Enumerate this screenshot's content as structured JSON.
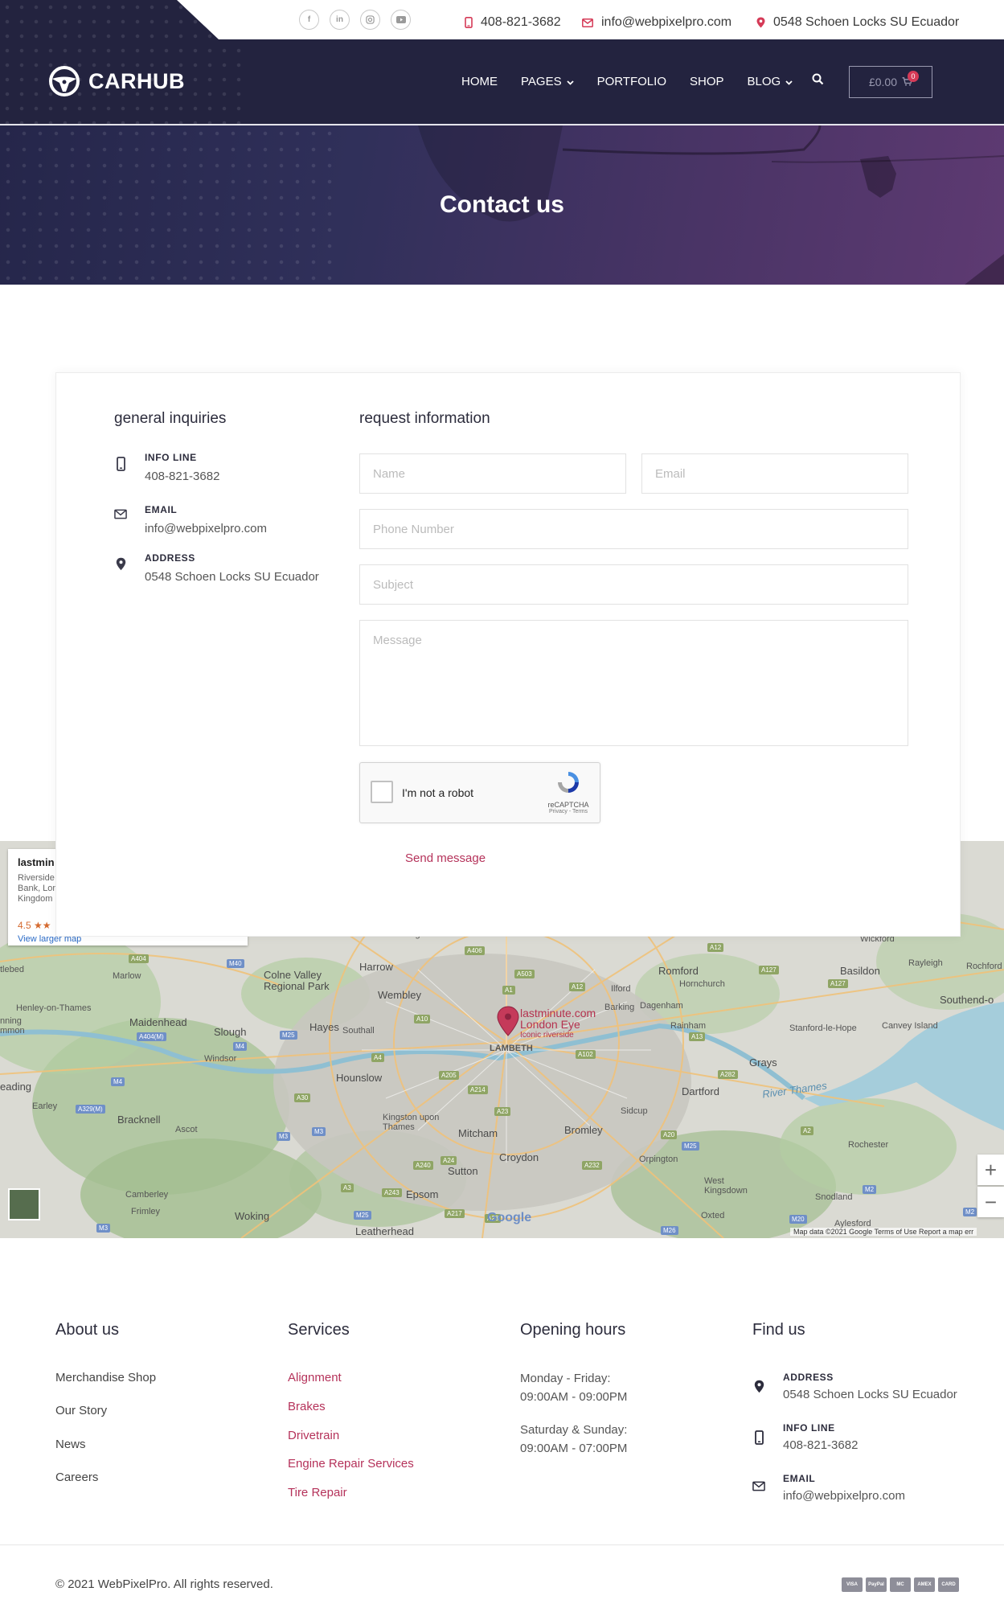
{
  "topbar": {
    "socials": [
      "facebook-icon",
      "linkedin-icon",
      "instagram-icon",
      "youtube-icon"
    ],
    "phone": "408-821-3682",
    "email": "info@webpixelpro.com",
    "address": "0548 Schoen Locks SU Ecuador"
  },
  "brand": {
    "name": "CARHUB"
  },
  "nav": {
    "items": [
      {
        "label": "HOME",
        "dropdown": false
      },
      {
        "label": "PAGES",
        "dropdown": true
      },
      {
        "label": "PORTFOLIO",
        "dropdown": false
      },
      {
        "label": "SHOP",
        "dropdown": false
      },
      {
        "label": "BLOG",
        "dropdown": true
      }
    ],
    "cart_amount": "£0.00",
    "cart_count": "0"
  },
  "hero": {
    "title": "Contact us"
  },
  "inquiries": {
    "heading": "general inquiries",
    "items": [
      {
        "icon": "phone-icon",
        "label": "INFO LINE",
        "value": "408-821-3682"
      },
      {
        "icon": "mail-icon",
        "label": "EMAIL",
        "value": "info@webpixelpro.com"
      },
      {
        "icon": "map-pin-icon",
        "label": "ADDRESS",
        "value": "0548 Schoen Locks SU Ecuador"
      }
    ]
  },
  "form": {
    "heading": "request information",
    "name_placeholder": "Name",
    "email_placeholder": "Email",
    "phone_placeholder": "Phone Number",
    "subject_placeholder": "Subject",
    "message_placeholder": "Message",
    "captcha_label": "I'm not a robot",
    "captcha_brand": "reCAPTCHA",
    "captcha_legal": "Privacy - Terms",
    "submit_label": "Send message"
  },
  "map": {
    "card_title": "lastmin",
    "card_address": "Riverside Bank, Lon Kingdom",
    "card_rating": "4.5 ★★",
    "card_link": "View larger map",
    "pin_title": "lastminute.com",
    "pin_line2": "London Eye",
    "pin_line3": "Iconic riverside",
    "places": [
      "Harrow",
      "Wembley",
      "Romford",
      "Basildon",
      "Rayleigh",
      "Southend-o",
      "Colne Valley Regional Park",
      "Maidenhead",
      "Slough",
      "Hayes",
      "Southall",
      "Ilford",
      "Barking",
      "Dagenham",
      "Rainham",
      "Stanford-le-Hope",
      "Canvey Island",
      "Hounslow",
      "Grays",
      "Dartford",
      "Bracknell",
      "Ascot",
      "Kingston upon Thames",
      "Mitcham",
      "Croydon",
      "Bromley",
      "Sidcup",
      "Orpington",
      "Sutton",
      "Epsom",
      "Woking",
      "Camberley",
      "Frimley",
      "Leatherhead",
      "West Kingsdown",
      "Snodland",
      "Rochester",
      "Windsor",
      "Marlow",
      "Henley-on-Thames",
      "Earley",
      "eading",
      "Oxted",
      "Aylesford",
      "LAMBETH",
      "Hornchurch",
      "River Thames",
      "Wickford",
      "Rochford",
      "Edgware",
      "tlebed",
      "nning mmon"
    ],
    "roads": [
      "A404",
      "M40",
      "A406",
      "A503",
      "A12",
      "A127",
      "A12",
      "A1",
      "A10",
      "A404(M)",
      "M25",
      "M4",
      "A4",
      "A205",
      "A214",
      "A102",
      "A13",
      "A282",
      "M4",
      "A329(M)",
      "A30",
      "M3",
      "M3",
      "A240",
      "A24",
      "A23",
      "A232",
      "A20",
      "M25",
      "A2",
      "M2",
      "A3",
      "A243",
      "A217",
      "A23",
      "M25",
      "M26",
      "M20",
      "M2",
      "M3",
      "A127"
    ],
    "attribution": "Map data ©2021 Google   Terms of Use   Report a map err",
    "google": "Google"
  },
  "footer": {
    "about": {
      "title": "About us",
      "links": [
        "Merchandise Shop",
        "Our Story",
        "News",
        "Careers"
      ]
    },
    "services": {
      "title": "Services",
      "links": [
        "Alignment",
        "Brakes",
        "Drivetrain",
        "Engine Repair Services",
        "Tire Repair"
      ]
    },
    "hours": {
      "title": "Opening hours",
      "weekday_label": "Monday - Friday:",
      "weekday_time": "09:00AM - 09:00PM",
      "weekend_label": "Saturday & Sunday:",
      "weekend_time": "09:00AM - 07:00PM"
    },
    "find": {
      "title": "Find us",
      "items": [
        {
          "icon": "map-pin-icon",
          "label": "ADDRESS",
          "value": "0548 Schoen Locks SU Ecuador"
        },
        {
          "icon": "phone-icon",
          "label": "INFO LINE",
          "value": "408-821-3682"
        },
        {
          "icon": "mail-icon",
          "label": "EMAIL",
          "value": "info@webpixelpro.com"
        }
      ]
    },
    "copyright": "© 2021 WebPixelPro. All rights reserved.",
    "payments": [
      "VISA",
      "PayPal",
      "MC",
      "AMEX",
      "CARD"
    ]
  },
  "colors": {
    "navy": "#23233f",
    "accent": "#d53a57",
    "link_red": "#b5325a"
  }
}
